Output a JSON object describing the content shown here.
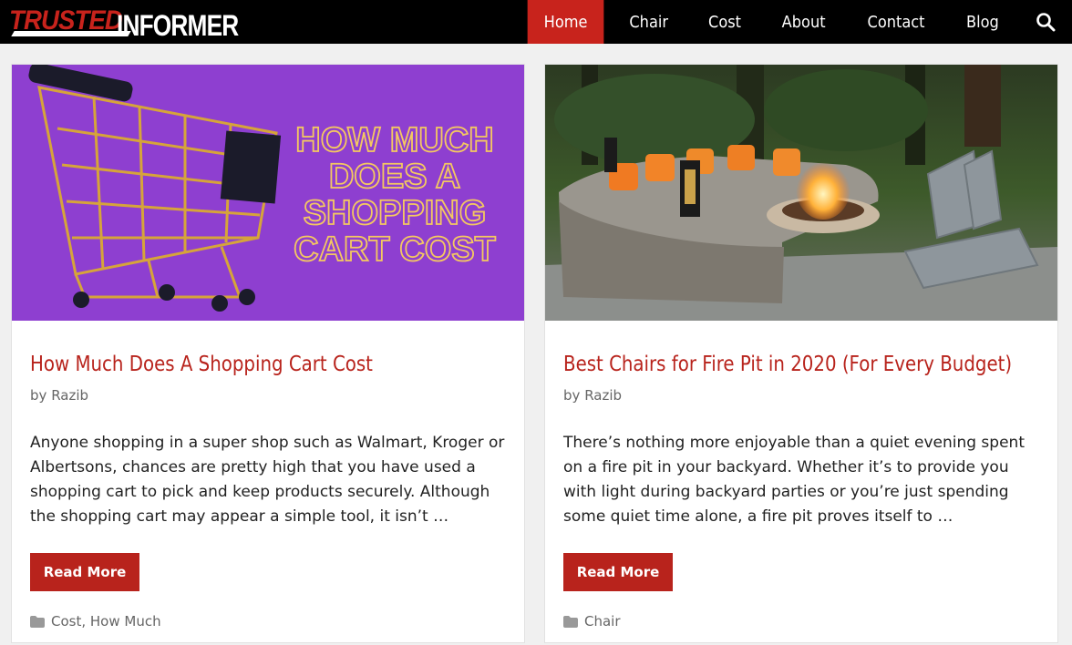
{
  "site": {
    "logo_part1": "TRUSTED",
    "logo_part2": "INFORMER"
  },
  "nav": {
    "items": [
      "Home",
      "Chair",
      "Cost",
      "About",
      "Contact",
      "Blog"
    ],
    "active": "Home",
    "search_icon": "search-icon"
  },
  "posts": [
    {
      "title": "How Much Does A Shopping Cart Cost",
      "byline_prefix": "by",
      "author": "Razib",
      "excerpt": "Anyone shopping in a super shop such as Walmart, Kroger or Albertsons, chances are pretty high that you have used a shopping cart to pick and keep products securely. Although the shopping cart may appear a simple tool, it isn’t …",
      "read_more": "Read More",
      "categories": [
        "Cost",
        "How Much"
      ],
      "image_text": [
        "HOW MUCH",
        "DOES A",
        "SHOPPING",
        "CART COST"
      ]
    },
    {
      "title": "Best Chairs for Fire Pit in 2020 (For Every Budget)",
      "byline_prefix": "by",
      "author": "Razib",
      "excerpt": "There’s nothing more enjoyable than a quiet evening spent on a fire pit in your backyard. Whether it’s to provide you with light during backyard parties or you’re just spending some quiet time alone, a fire pit proves itself to …",
      "read_more": "Read More",
      "categories": [
        "Chair"
      ]
    }
  ],
  "colors": {
    "accent": "#c8231c",
    "header_bg": "#000000",
    "thumb_purple": "#8e3fd0"
  }
}
